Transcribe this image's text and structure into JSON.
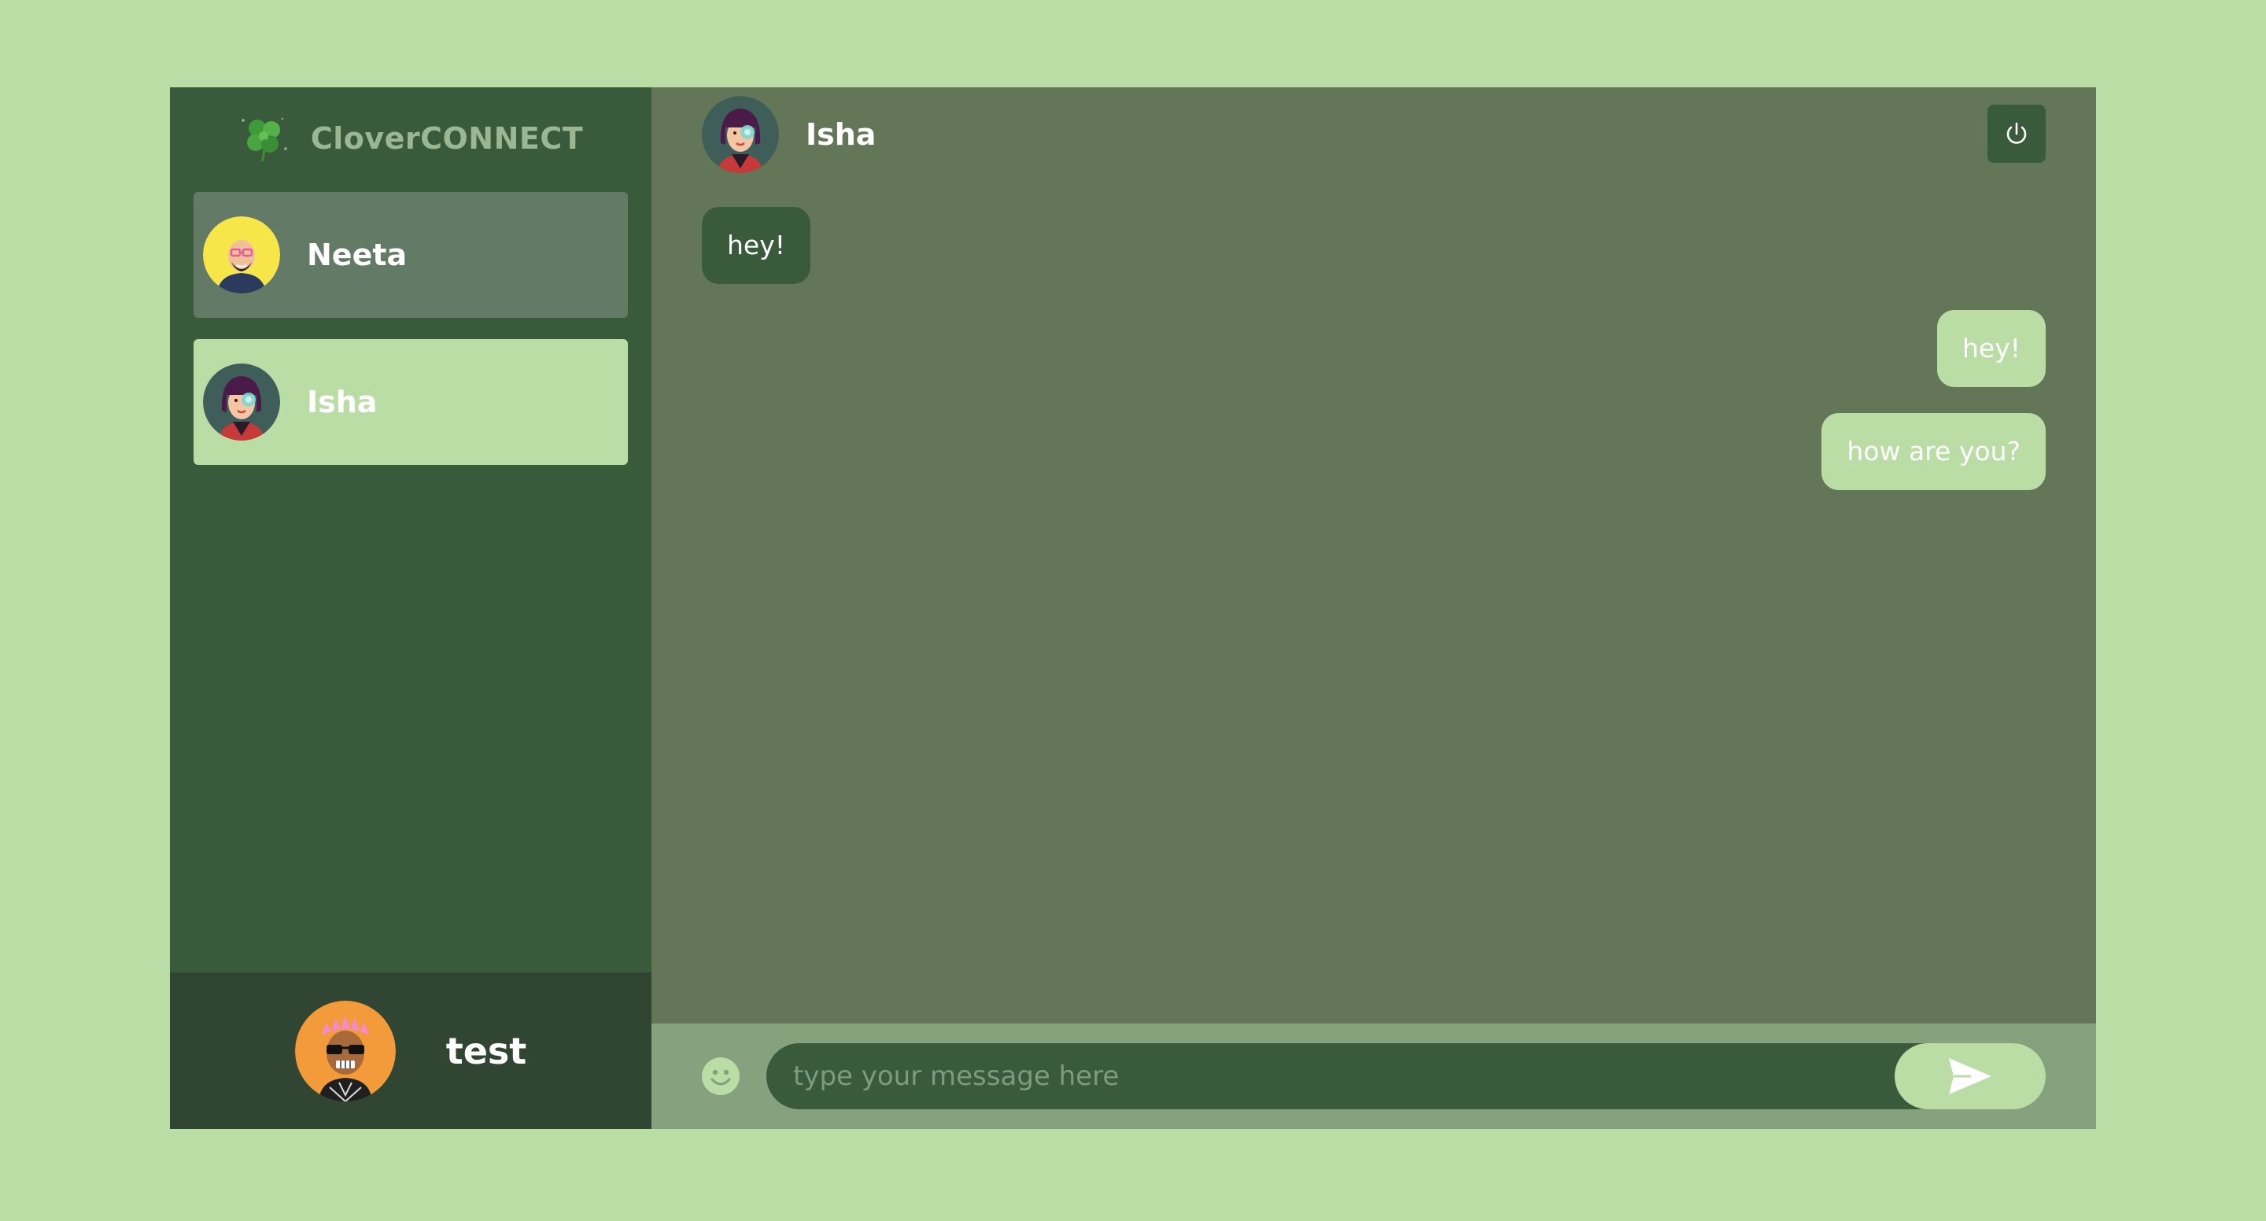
{
  "colors": {
    "page_bg": "#badda5",
    "sidebar_bg": "#3a5a3c",
    "chat_bg": "#637758",
    "accent": "#badda5"
  },
  "brand": {
    "icon": "clover-icon",
    "name": "CloverCONNECT"
  },
  "contacts": [
    {
      "name": "Neeta",
      "avatar": "neeta-avatar",
      "active": false
    },
    {
      "name": "Isha",
      "avatar": "isha-avatar",
      "active": true
    }
  ],
  "current_user": {
    "name": "test",
    "avatar": "test-avatar"
  },
  "chat": {
    "contact_name": "Isha",
    "logout_icon": "power-icon",
    "messages": [
      {
        "direction": "incoming",
        "text": "hey!"
      },
      {
        "direction": "outgoing",
        "text": "hey!"
      },
      {
        "direction": "outgoing",
        "text": "how are you?"
      }
    ]
  },
  "composer": {
    "emoji_icon": "smiley-icon",
    "placeholder": "type your message here",
    "value": "",
    "send_icon": "send-icon"
  }
}
